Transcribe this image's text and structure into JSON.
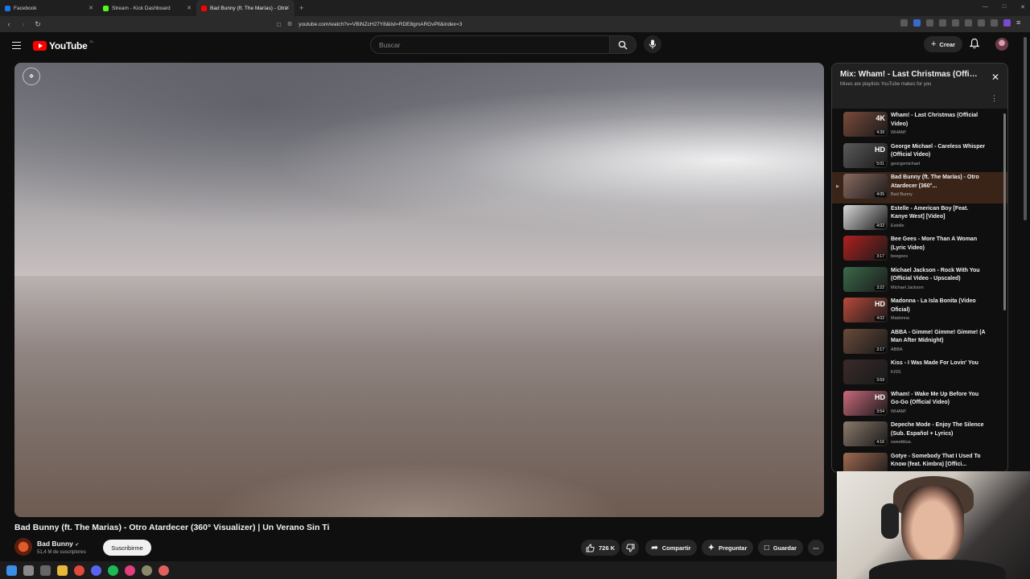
{
  "browser": {
    "tabs": [
      {
        "title": "Facebook",
        "color": "#1877f2",
        "active": false
      },
      {
        "title": "Stream - Kick Dashboard",
        "color": "#53fc18",
        "active": false
      },
      {
        "title": "Bad Bunny (ft. The Marías) - Otro",
        "color": "#ff0000",
        "active": true
      }
    ],
    "url": "youtube.com/watch?v=VBiNZcH27Y8&list=RDE8gmARGvPlI&index=3"
  },
  "header": {
    "logo_text": "YouTube",
    "logo_country": "CL",
    "search_placeholder": "Buscar",
    "create_label": "Crear"
  },
  "video": {
    "title": "Bad Bunny (ft. The Marias) - Otro Atardecer (360° Visualizer) | Un Verano Sin Ti",
    "channel": "Bad Bunny",
    "subscribers": "51,4 M de suscriptores",
    "subscribe_label": "Suscribirme",
    "likes": "726 K",
    "share_label": "Compartir",
    "ask_label": "Preguntar",
    "save_label": "Guardar"
  },
  "playlist": {
    "title": "Mix: Wham! - Last Christmas (Official Video)",
    "subtitle": "Mixes are playlists YouTube makes for you",
    "items": [
      {
        "title": "Wham! - Last Christmas (Official Video)",
        "channel": "WHAM!",
        "duration": "4:39",
        "badge": "4K",
        "color": "#7a4a3a",
        "active": false
      },
      {
        "title": "George Michael - Careless Whisper (Official Video)",
        "channel": "georgemichael",
        "duration": "5:01",
        "badge": "HD",
        "color": "#5a5a5a",
        "active": false
      },
      {
        "title": "Bad Bunny (ft. The Marías) - Otro Atardecer (360°...",
        "channel": "Bad Bunny",
        "duration": "4:05",
        "badge": "",
        "color": "#8a6a60",
        "active": true
      },
      {
        "title": "Estelle - American Boy [Feat. Kanye West] [Video]",
        "channel": "Estelle",
        "duration": "4:02",
        "badge": "",
        "color": "#d8d8d8",
        "active": false
      },
      {
        "title": "Bee Gees - More Than A Woman (Lyric Video)",
        "channel": "beegees",
        "duration": "3:17",
        "badge": "",
        "color": "#b02020",
        "active": false
      },
      {
        "title": "Michael Jackson - Rock With You (Official Video - Upscaled)",
        "channel": "Michael Jackson",
        "duration": "3:22",
        "badge": "",
        "color": "#3a6a4a",
        "active": false
      },
      {
        "title": "Madonna - La Isla Bonita (Video Oficial)",
        "channel": "Madonna",
        "duration": "4:02",
        "badge": "HD",
        "color": "#b84a3a",
        "active": false
      },
      {
        "title": "ABBA - Gimme! Gimme! Gimme! (A Man After Midnight)",
        "channel": "ABBA",
        "duration": "3:17",
        "badge": "",
        "color": "#6a4a3a",
        "active": false
      },
      {
        "title": "Kiss - I Was Made For Lovin' You",
        "channel": "KISS",
        "duration": "3:59",
        "badge": "",
        "color": "#3a2a2a",
        "active": false
      },
      {
        "title": "Wham! - Wake Me Up Before You Go-Go (Official Video)",
        "channel": "WHAM!",
        "duration": "3:54",
        "badge": "HD",
        "color": "#c86a7a",
        "active": false
      },
      {
        "title": "Depeche Mode - Enjoy The Silence (Sub. Español + Lyrics)",
        "channel": "sweetblue.",
        "duration": "4:16",
        "badge": "",
        "color": "#8a7a6a",
        "active": false
      },
      {
        "title": "Gotye - Somebody That I Used To Know (feat. Kimbra) [Offici...",
        "channel": "",
        "duration": "4:04",
        "badge": "",
        "color": "#a06a50",
        "active": false
      }
    ]
  },
  "taskbar": {
    "icon_colors": [
      "#3a8ee6",
      "#888888",
      "#666666",
      "#e8b83a",
      "#e04a3a",
      "#5865f2",
      "#1db954",
      "#e0407a",
      "#8a8a6a",
      "#e06060"
    ]
  }
}
